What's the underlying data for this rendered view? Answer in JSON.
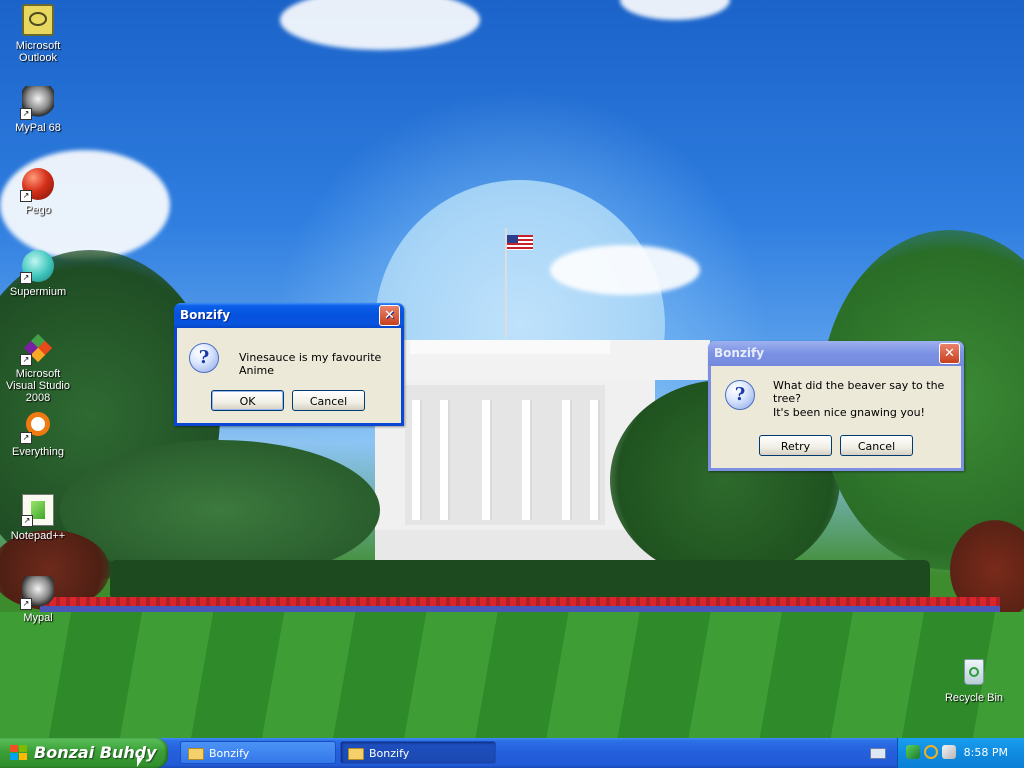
{
  "desktop": {
    "icons": [
      {
        "label": "Microsoft Outlook",
        "icon": "outlook-icon",
        "shortcut": false
      },
      {
        "label": "MyPal 68",
        "icon": "raccoon-icon",
        "shortcut": true
      },
      {
        "label": "Pego",
        "icon": "red-ball-icon",
        "shortcut": true
      },
      {
        "label": "Supermium",
        "icon": "supermium-icon",
        "shortcut": true
      },
      {
        "label": "Microsoft Visual Studio 2008",
        "icon": "visual-studio-icon",
        "shortcut": true
      },
      {
        "label": "Everything",
        "icon": "everything-icon",
        "shortcut": true
      },
      {
        "label": "Notepad++",
        "icon": "notepadpp-icon",
        "shortcut": true
      },
      {
        "label": "Mypal",
        "icon": "raccoon-icon",
        "shortcut": true
      },
      {
        "label": "Recycle Bin",
        "icon": "recycle-bin-icon",
        "shortcut": false
      }
    ]
  },
  "dialogs": [
    {
      "title": "Bonzify",
      "message_lines": [
        "Vinesauce is my favourite Anime"
      ],
      "buttons": [
        "OK",
        "Cancel"
      ],
      "icon": "question-icon",
      "active": true
    },
    {
      "title": "Bonzify",
      "message_lines": [
        "What did the beaver say to the tree?",
        "It's been nice gnawing you!"
      ],
      "buttons": [
        "Retry",
        "Cancel"
      ],
      "icon": "question-icon",
      "active": false
    }
  ],
  "taskbar": {
    "start_label": "Bonzai Buhdy",
    "tasks": [
      {
        "label": "Bonzify",
        "active": false
      },
      {
        "label": "Bonzify",
        "active": true
      }
    ],
    "clock": "8:58 PM",
    "tray_icons": [
      "network-icon",
      "search-icon",
      "speaker-icon"
    ]
  },
  "colors": {
    "xp_blue_titlebar": "#0552df",
    "inactive_titlebar": "#7b92e4",
    "dialog_face": "#ece9d8",
    "start_green": "#3b9f37",
    "taskbar_blue": "#245edb",
    "tray_blue": "#0f8be0"
  }
}
